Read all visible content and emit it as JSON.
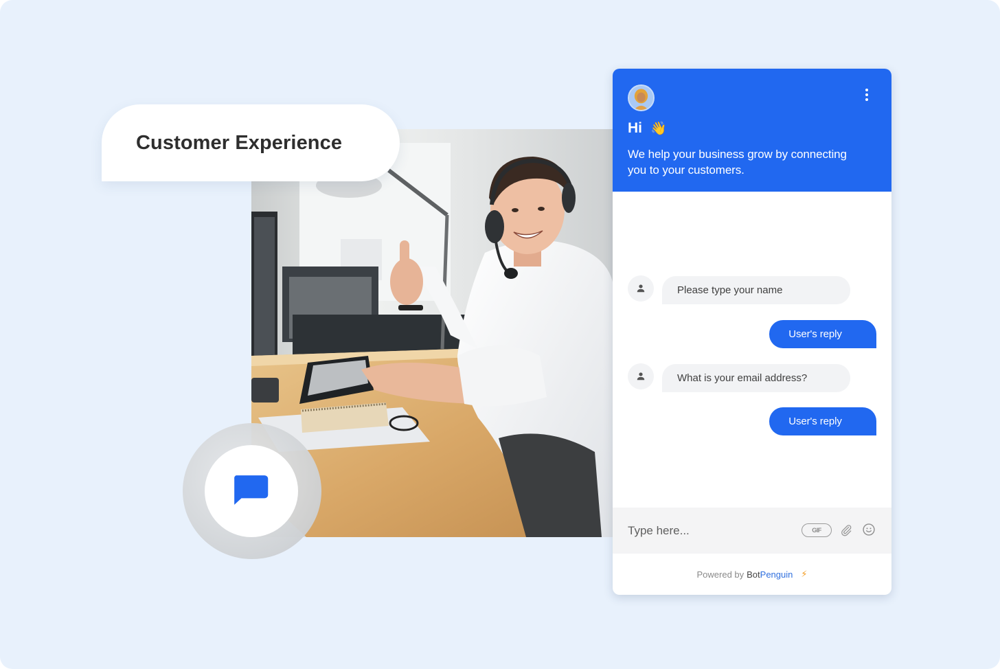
{
  "label_card": {
    "title": "Customer Experience"
  },
  "photo": {
    "description": "Smiling customer support agent wearing a headset giving a thumbs up at a desk"
  },
  "launcher": {
    "icon": "chat-bubble-icon"
  },
  "widget": {
    "header": {
      "greeting": "Hi",
      "greeting_emoji": "👋",
      "subtitle": "We help your business grow by connecting you to your customers.",
      "menu_icon": "kebab-menu-icon"
    },
    "messages": [
      {
        "sender": "bot",
        "text": "Please type your name"
      },
      {
        "sender": "user",
        "text": "User's reply"
      },
      {
        "sender": "bot",
        "text": "What is your email address?"
      },
      {
        "sender": "user",
        "text": "User's reply"
      }
    ],
    "input": {
      "placeholder": "Type here...",
      "gif_label": "GIF",
      "attach_icon": "paperclip-icon",
      "emoji_icon": "smiley-icon"
    },
    "footer": {
      "powered_by": "Powered by",
      "brand_part1": "Bot",
      "brand_part2": "Penguin",
      "bolt": "⚡"
    }
  },
  "colors": {
    "accent": "#2168f0",
    "background": "#e8f1fc",
    "bubble_bot": "#f2f3f5"
  }
}
